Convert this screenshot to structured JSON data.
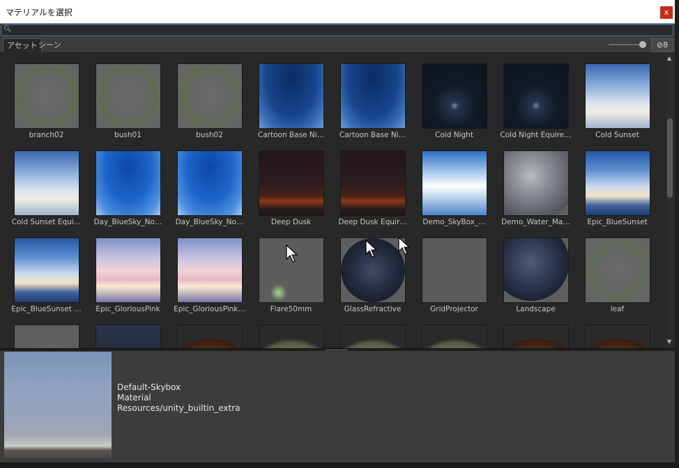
{
  "window": {
    "title": "マテリアルを選択",
    "close_label": "x"
  },
  "search": {
    "placeholder": "",
    "value": "",
    "icon": "search-icon"
  },
  "tabs": [
    {
      "label": "アセット",
      "active": true
    },
    {
      "label": "シーン",
      "active": false
    }
  ],
  "hidden_count": "8",
  "items": [
    {
      "label": "branch02",
      "thumb": "branch"
    },
    {
      "label": "bush01",
      "thumb": "branch"
    },
    {
      "label": "bush02",
      "thumb": "branch"
    },
    {
      "label": "Cartoon Base Ni…",
      "thumb": "bluesky"
    },
    {
      "label": "Cartoon Base Ni…",
      "thumb": "bluesky"
    },
    {
      "label": "Cold Night",
      "thumb": "night"
    },
    {
      "label": "Cold Night Equire…",
      "thumb": "night"
    },
    {
      "label": "Cold Sunset",
      "thumb": "cloudsky"
    },
    {
      "label": "Cold Sunset Equi…",
      "thumb": "cloudsky"
    },
    {
      "label": "Day_BlueSky_No…",
      "thumb": "daysky"
    },
    {
      "label": "Day_BlueSky_No…",
      "thumb": "daysky"
    },
    {
      "label": "Deep Dusk",
      "thumb": "dusk"
    },
    {
      "label": "Deep Dusk Equir…",
      "thumb": "dusk"
    },
    {
      "label": "Demo_SkyBox_…",
      "thumb": "demosky"
    },
    {
      "label": "Demo_Water_Ma…",
      "thumb": "glassball"
    },
    {
      "label": "Epic_BlueSunset",
      "thumb": "bluesunset"
    },
    {
      "label": "Epic_BlueSunset …",
      "thumb": "bluesunset"
    },
    {
      "label": "Epic_GloriousPink",
      "thumb": "pinksky"
    },
    {
      "label": "Epic_GloriousPink…",
      "thumb": "pinksky"
    },
    {
      "label": "Flare50mm",
      "thumb": "flare"
    },
    {
      "label": "GlassRefractive",
      "thumb": "mosaic"
    },
    {
      "label": "GridProjector",
      "thumb": "grid"
    },
    {
      "label": "Landscape",
      "thumb": "darkball"
    },
    {
      "label": "leaf",
      "thumb": "branch"
    },
    {
      "label": "",
      "thumb": "greyball"
    },
    {
      "label": "",
      "thumb": "darknight"
    },
    {
      "label": "",
      "thumb": "terrain"
    },
    {
      "label": "",
      "thumb": "terrain2"
    },
    {
      "label": "",
      "thumb": "terrain2"
    },
    {
      "label": "",
      "thumb": "terrain2"
    },
    {
      "label": "",
      "thumb": "terrain"
    },
    {
      "label": "",
      "thumb": "terrain"
    }
  ],
  "selected": {
    "name": "Default-Skybox",
    "type": "Material",
    "path": "Resources/unity_builtin_extra"
  }
}
